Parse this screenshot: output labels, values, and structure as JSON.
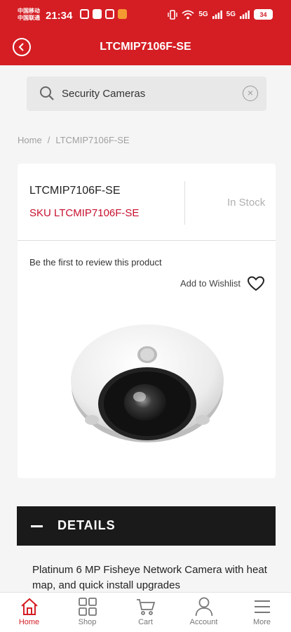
{
  "status_bar": {
    "carrier_1": "中国移动",
    "carrier_2": "中国联通",
    "time": "21:34",
    "signal_1": "5G",
    "signal_2": "5G",
    "battery": "34"
  },
  "header": {
    "title": "LTCMIP7106F-SE",
    "background": "#d41e24"
  },
  "search": {
    "value": "Security Cameras",
    "icon": "search-icon",
    "clear_icon": "clear-icon"
  },
  "breadcrumb": {
    "home": "Home",
    "separator": "/",
    "current": "LTCMIP7106F-SE"
  },
  "product": {
    "name": "LTCMIP7106F-SE",
    "sku": "SKU LTCMIP7106F-SE",
    "stock": "In Stock",
    "review": "Be the first to review this product",
    "wishlist": "Add to Wishlist"
  },
  "details": {
    "label": "DETAILS",
    "description": "Platinum 6 MP Fisheye Network Camera with heat map, and quick install upgrades"
  },
  "nav": {
    "items": [
      {
        "label": "Home",
        "icon": "home-icon",
        "active": true
      },
      {
        "label": "Shop",
        "icon": "grid-icon",
        "active": false
      },
      {
        "label": "Cart",
        "icon": "cart-icon",
        "active": false
      },
      {
        "label": "Account",
        "icon": "user-icon",
        "active": false
      },
      {
        "label": "More",
        "icon": "menu-icon",
        "active": false
      }
    ],
    "active_color": "#d41e24"
  }
}
